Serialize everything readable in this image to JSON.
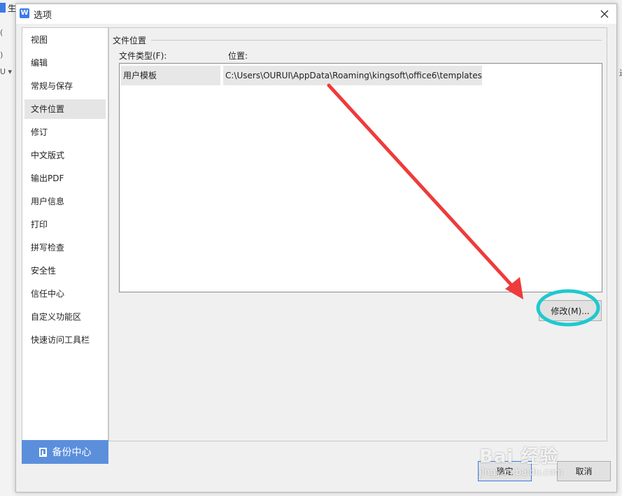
{
  "background_app": {
    "title_char": "生",
    "row1": "(",
    "row2": ")",
    "row3": "U ▾",
    "right_char": "迸"
  },
  "dialog": {
    "title": "选项",
    "app_icon": "W",
    "close_icon": "close-icon"
  },
  "sidebar": {
    "items": [
      {
        "label": "视图"
      },
      {
        "label": "编辑"
      },
      {
        "label": "常规与保存"
      },
      {
        "label": "文件位置",
        "active": true
      },
      {
        "label": "修订"
      },
      {
        "label": "中文版式"
      },
      {
        "label": "输出PDF"
      },
      {
        "label": "用户信息"
      },
      {
        "label": "打印"
      },
      {
        "label": "拼写检查"
      },
      {
        "label": "安全性"
      },
      {
        "label": "信任中心"
      },
      {
        "label": "自定义功能区"
      },
      {
        "label": "快速访问工具栏"
      }
    ],
    "backup_label": "备份中心"
  },
  "content": {
    "group_title": "文件位置",
    "col_type": "文件类型(F):",
    "col_location": "位置:",
    "rows": [
      {
        "type": "用户模板",
        "path": "C:\\Users\\OURUI\\AppData\\Roaming\\kingsoft\\office6\\templates"
      }
    ],
    "modify_label": "修改(M)..."
  },
  "footer": {
    "ok_label": "确定",
    "cancel_label": "取消"
  },
  "colors": {
    "accent": "#3c7be5",
    "backup_bg": "#5b8fdc",
    "arrow": "#ee3b3b",
    "highlight_ring": "#1ec9cf"
  },
  "watermark": {
    "brand": "Bai 经验",
    "sub": "jingyan.baidu.com"
  }
}
